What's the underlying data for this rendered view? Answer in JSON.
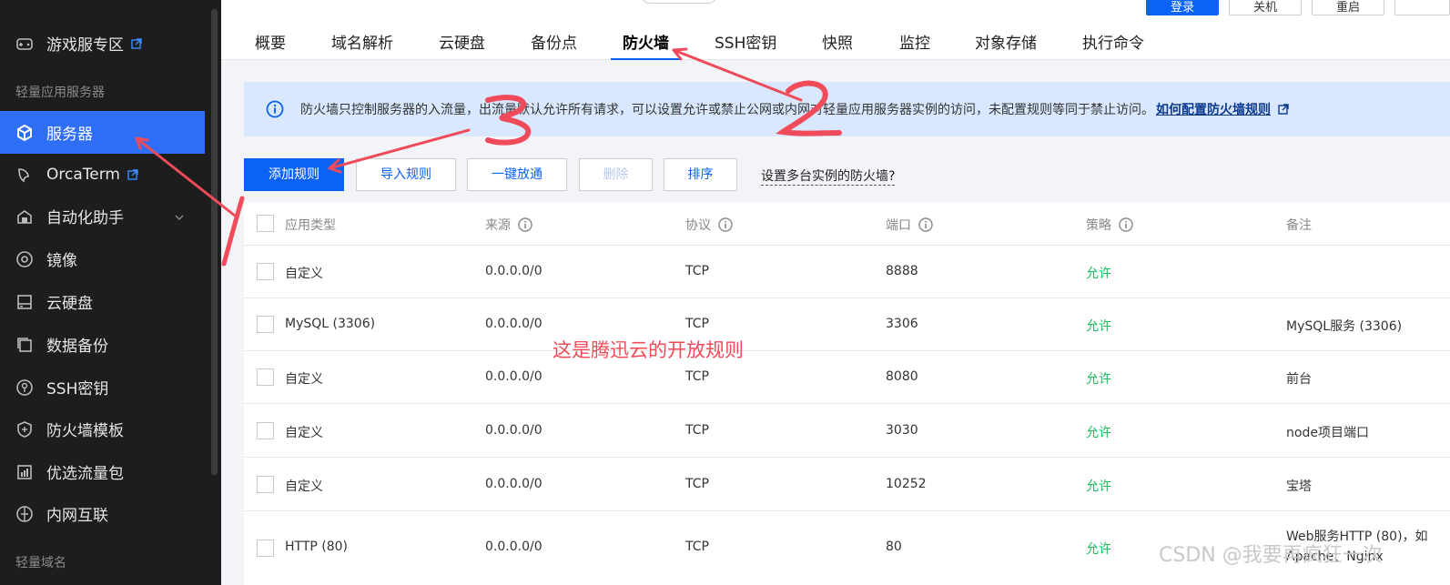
{
  "sidebar": {
    "items_top": [
      {
        "label": "游戏服专区",
        "icon": "gamepad-icon",
        "external": true
      }
    ],
    "section1": "轻量应用服务器",
    "items": [
      {
        "label": "服务器",
        "icon": "cube-icon",
        "active": true
      },
      {
        "label": "OrcaTerm",
        "icon": "terminal-icon",
        "external": true
      },
      {
        "label": "自动化助手",
        "icon": "robot-icon",
        "expandable": true
      },
      {
        "label": "镜像",
        "icon": "disc-icon"
      },
      {
        "label": "云硬盘",
        "icon": "disk-icon"
      },
      {
        "label": "数据备份",
        "icon": "backup-icon"
      },
      {
        "label": "SSH密钥",
        "icon": "key-icon"
      },
      {
        "label": "防火墙模板",
        "icon": "shield-icon"
      },
      {
        "label": "优选流量包",
        "icon": "traffic-icon"
      },
      {
        "label": "内网互联",
        "icon": "network-icon"
      }
    ],
    "section2": "轻量域名"
  },
  "topbar": {
    "buttons": [
      "登录",
      "关机",
      "重启",
      ""
    ],
    "tabs": [
      "概要",
      "域名解析",
      "云硬盘",
      "备份点",
      "防火墙",
      "SSH密钥",
      "快照",
      "监控",
      "对象存储",
      "执行命令"
    ],
    "active_tab": "防火墙"
  },
  "notice": {
    "text": "防火墙只控制服务器的入流量，出流量默认允许所有请求，可以设置允许或禁止公网或内网对轻量应用服务器实例的访问，未配置规则等同于禁止访问。",
    "link": "如何配置防火墙规则"
  },
  "actions": {
    "add": "添加规则",
    "import": "导入规则",
    "allow_all": "一键放通",
    "delete": "删除",
    "sort": "排序",
    "multi_link": "设置多台实例的防火墙?"
  },
  "table": {
    "columns": [
      "应用类型",
      "来源",
      "协议",
      "端口",
      "策略",
      "备注"
    ],
    "rows": [
      {
        "type": "自定义",
        "source": "0.0.0.0/0",
        "protocol": "TCP",
        "port": "8888",
        "policy": "允许",
        "note": ""
      },
      {
        "type": "MySQL (3306)",
        "source": "0.0.0.0/0",
        "protocol": "TCP",
        "port": "3306",
        "policy": "允许",
        "note": "MySQL服务 (3306)"
      },
      {
        "type": "自定义",
        "source": "0.0.0.0/0",
        "protocol": "TCP",
        "port": "8080",
        "policy": "允许",
        "note": "前台"
      },
      {
        "type": "自定义",
        "source": "0.0.0.0/0",
        "protocol": "TCP",
        "port": "3030",
        "policy": "允许",
        "note": "node项目端口"
      },
      {
        "type": "自定义",
        "source": "0.0.0.0/0",
        "protocol": "TCP",
        "port": "10252",
        "policy": "允许",
        "note": "宝塔"
      },
      {
        "type": "HTTP (80)",
        "source": "0.0.0.0/0",
        "protocol": "TCP",
        "port": "80",
        "policy": "允许",
        "note": "Web服务HTTP (80)，如",
        "note2": "Apache、Nginx"
      }
    ]
  },
  "annotations": {
    "text": "这是腾迅云的开放规则",
    "marks": [
      "1",
      "2",
      "3"
    ],
    "color": "#f04b5a"
  },
  "watermark": "CSDN @我要再疯狂一次"
}
